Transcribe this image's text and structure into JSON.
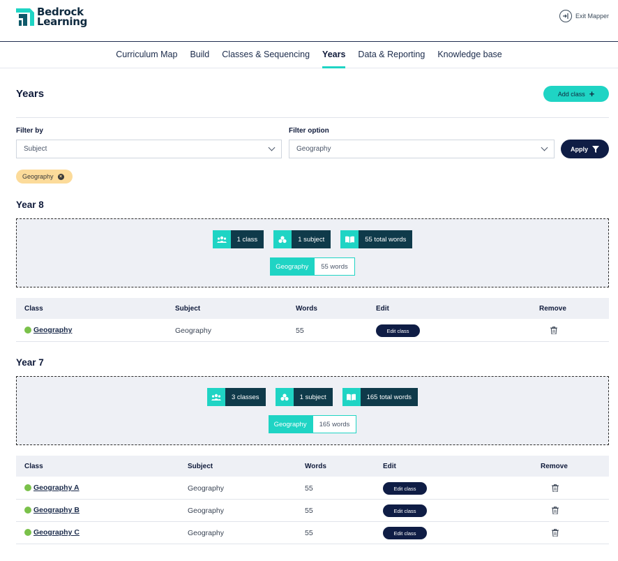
{
  "header": {
    "logo_line1": "Bedrock",
    "logo_line2": "Learning",
    "exit_label": "Exit Mapper"
  },
  "nav": {
    "items": [
      "Curriculum Map",
      "Build",
      "Classes & Sequencing",
      "Years",
      "Data & Reporting",
      "Knowledge base"
    ],
    "active": "Years"
  },
  "page": {
    "title": "Years",
    "add_class_label": "Add class"
  },
  "filters": {
    "filter_by_label": "Filter by",
    "filter_by_value": "Subject",
    "filter_option_label": "Filter option",
    "filter_option_value": "Geography",
    "apply_label": "Apply",
    "active_chip": "Geography"
  },
  "table_headers": {
    "class": "Class",
    "subject": "Subject",
    "words": "Words",
    "edit": "Edit",
    "remove": "Remove"
  },
  "years": [
    {
      "title": "Year 8",
      "stats": {
        "classes": "1 class",
        "subjects": "1 subject",
        "words": "55 total words"
      },
      "subject_breakdown": {
        "name": "Geography",
        "words": "55 words"
      },
      "rows": [
        {
          "class": "Geography",
          "subject": "Geography",
          "words": "55",
          "edit_label": "Edit class"
        }
      ]
    },
    {
      "title": "Year 7",
      "stats": {
        "classes": "3 classes",
        "subjects": "1 subject",
        "words": "165 total words"
      },
      "subject_breakdown": {
        "name": "Geography",
        "words": "165 words"
      },
      "rows": [
        {
          "class": "Geography A",
          "subject": "Geography",
          "words": "55",
          "edit_label": "Edit class"
        },
        {
          "class": "Geography B",
          "subject": "Geography",
          "words": "55",
          "edit_label": "Edit class"
        },
        {
          "class": "Geography C",
          "subject": "Geography",
          "words": "55",
          "edit_label": "Edit class"
        }
      ]
    }
  ],
  "colors": {
    "accent": "#1fd4c4",
    "navy": "#0f1d45",
    "dark_teal": "#0f3a4a",
    "chip": "#fcdb9a",
    "status_dot": "#7ac14a"
  },
  "icons": {
    "logo": "bedrock-logo-icon",
    "exit": "exit-icon",
    "add": "plus-icon",
    "apply": "filter-icon",
    "chip_remove": "close-circle-icon",
    "classes": "users-icon",
    "subjects": "subjects-icon",
    "words": "book-icon",
    "remove": "trash-icon"
  }
}
